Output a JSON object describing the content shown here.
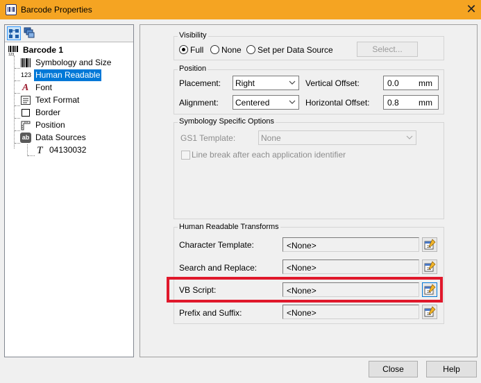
{
  "window": {
    "title": "Barcode Properties",
    "close_glyph": "✕"
  },
  "tree": {
    "root": {
      "label": "Barcode 1",
      "icon": "barcode-icon"
    },
    "items": [
      {
        "label": "Symbology and Size",
        "icon": "barcode-lines-icon"
      },
      {
        "label": "Human Readable",
        "icon": "digits-123-icon",
        "icon_text": "123",
        "selected": true
      },
      {
        "label": "Font",
        "icon": "font-a-icon",
        "icon_text": "A"
      },
      {
        "label": "Text Format",
        "icon": "text-format-icon"
      },
      {
        "label": "Border",
        "icon": "border-icon"
      },
      {
        "label": "Position",
        "icon": "position-ruler-icon"
      },
      {
        "label": "Data Sources",
        "icon": "data-source-ab-icon",
        "icon_text": "ab"
      }
    ],
    "data_source_child": {
      "label": "04130032",
      "icon": "text-t-icon",
      "icon_text": "T"
    }
  },
  "visibility": {
    "title": "Visibility",
    "options": [
      "Full",
      "None",
      "Set per Data Source"
    ],
    "selected": "Full",
    "select_button": "Select..."
  },
  "position": {
    "title": "Position",
    "placement_label": "Placement:",
    "placement_value": "Right",
    "alignment_label": "Alignment:",
    "alignment_value": "Centered",
    "vertical_offset_label": "Vertical Offset:",
    "vertical_offset_value": "0.0",
    "horizontal_offset_label": "Horizontal Offset:",
    "horizontal_offset_value": "0.8",
    "unit": "mm"
  },
  "symbology_options": {
    "title": "Symbology Specific Options",
    "gs1_label": "GS1 Template:",
    "gs1_value": "None",
    "line_break_label": "Line break after each application identifier"
  },
  "transforms": {
    "title": "Human Readable Transforms",
    "rows": [
      {
        "label": "Character Template:",
        "value": "<None>"
      },
      {
        "label": "Search and Replace:",
        "value": "<None>"
      },
      {
        "label": "VB Script:",
        "value": "<None>"
      },
      {
        "label": "Prefix and Suffix:",
        "value": "<None>"
      }
    ]
  },
  "footer": {
    "close_button": "Close",
    "help_button": "Help"
  },
  "colors": {
    "titlebar": "#f5a422",
    "selection": "#0078d7",
    "highlight": "#e0182b"
  }
}
